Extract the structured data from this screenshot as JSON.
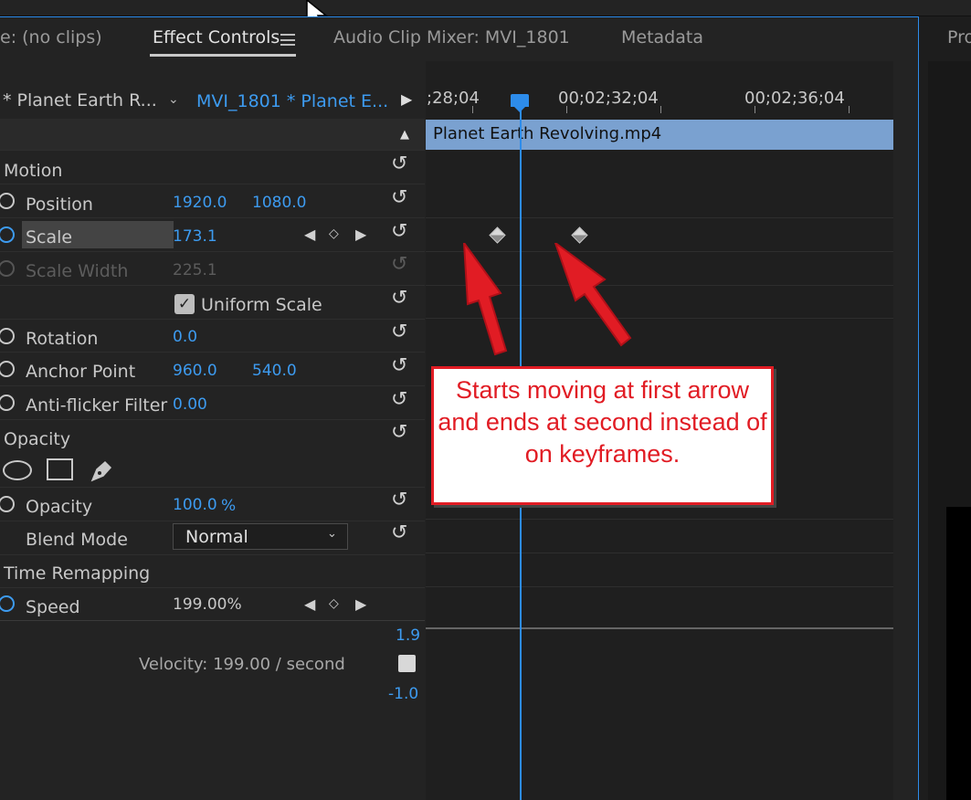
{
  "tabs": {
    "source_partial": "e: (no clips)",
    "effect_controls": "Effect Controls",
    "audio_clip_mixer": "Audio Clip Mixer: MVI_1801",
    "metadata": "Metadata",
    "program_partial": "Pro"
  },
  "header": {
    "master_clip": "* Planet Earth R...",
    "sequence_clip": "MVI_1801 * Planet E..."
  },
  "ruler": {
    "t1": ";28;04",
    "t2": "00;02;32;04",
    "t3": "00;02;36;04"
  },
  "clip_name": "Planet Earth Revolving.mp4",
  "motion": {
    "section_label": "Motion",
    "position": {
      "label": "Position",
      "x": "1920.0",
      "y": "1080.0"
    },
    "scale": {
      "label": "Scale",
      "value": "173.1"
    },
    "scale_width": {
      "label": "Scale Width",
      "value": "225.1"
    },
    "uniform_scale": {
      "label": "Uniform Scale",
      "checked": true
    },
    "rotation": {
      "label": "Rotation",
      "value": "0.0"
    },
    "anchor_point": {
      "label": "Anchor Point",
      "x": "960.0",
      "y": "540.0"
    },
    "anti_flicker": {
      "label": "Anti-flicker Filter",
      "value": "0.00"
    }
  },
  "opacity": {
    "section_label": "Opacity",
    "opacity": {
      "label": "Opacity",
      "value": "100.0",
      "unit": "%"
    },
    "blend_mode": {
      "label": "Blend Mode",
      "value": "Normal"
    }
  },
  "time_remapping": {
    "section_label": "Time Remapping",
    "speed": {
      "label": "Speed",
      "value": "199.00%"
    },
    "graph_max": "1.9",
    "graph_min": "-1.0",
    "velocity": "Velocity: 199.00 / second"
  },
  "annotation": {
    "text": "Starts moving at first arrow and ends at second instead of on keyframes."
  },
  "colors": {
    "accent": "#2d8ceb",
    "value_blue": "#3d9bf0",
    "clip_blue": "#7aa1d0",
    "annotation_red": "#e11c24"
  }
}
